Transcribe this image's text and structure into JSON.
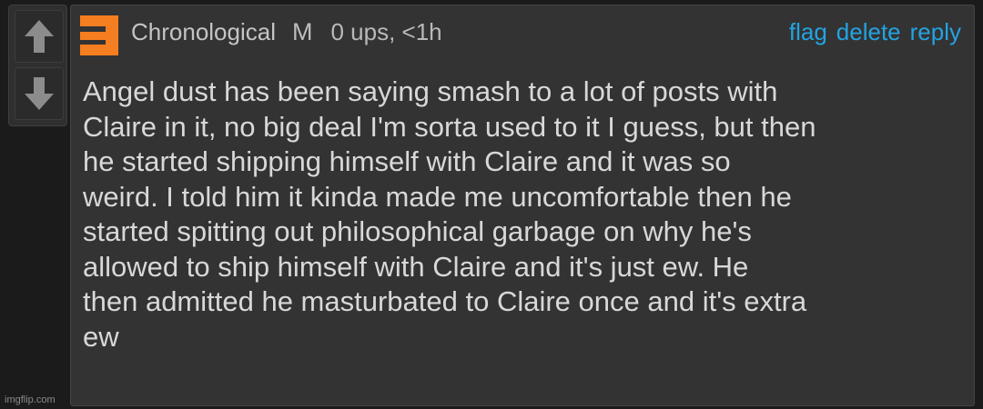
{
  "vote": {
    "up_icon": "arrow-up-icon",
    "down_icon": "arrow-down-icon"
  },
  "comment": {
    "avatar_icon": "orange-bracket-avatar-icon",
    "username": "Chronological",
    "badge": "M",
    "meta": "0 ups, <1h",
    "actions": {
      "flag": "flag",
      "delete": "delete",
      "reply": "reply"
    },
    "text": "Angel dust has been saying smash to a lot of posts with\nClaire in it, no big deal I'm sorta used to it I guess, but then\nhe started shipping himself with Claire and it was so\nweird. I told him it kinda made me uncomfortable then he\nstarted spitting out philosophical garbage on why he's\nallowed to ship himself with Claire and it's just ew. He\nthen admitted he masturbated to Claire once and it's extra\new"
  },
  "watermark": "imgflip.com",
  "colors": {
    "background": "#1b1b1b",
    "panel": "#333333",
    "link": "#23a3e3",
    "avatar": "#f57e20"
  }
}
